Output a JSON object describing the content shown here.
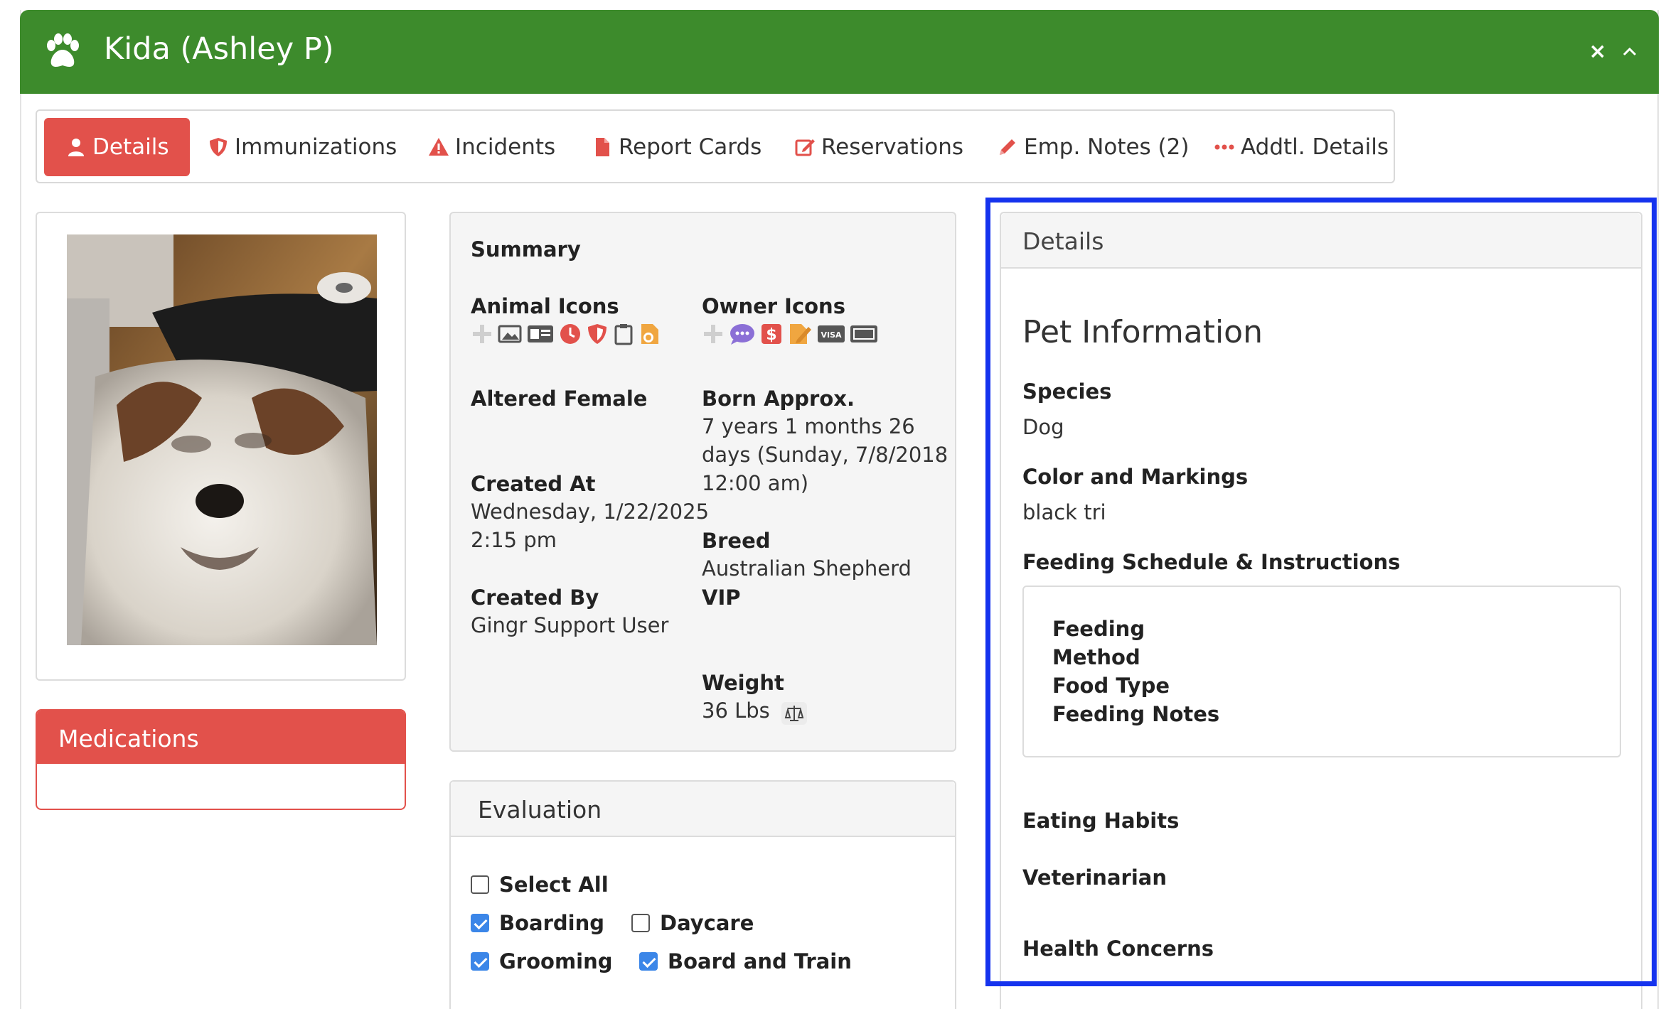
{
  "header": {
    "title": "Kida (Ashley P)",
    "close_symbol": "×",
    "collapse_symbol": "⌃",
    "accent": "#3d8b2c"
  },
  "tabs": [
    {
      "label": "Details",
      "icon": "user-icon"
    },
    {
      "label": "Immunizations",
      "icon": "shield-icon"
    },
    {
      "label": "Incidents",
      "icon": "warning-icon"
    },
    {
      "label": "Report Cards",
      "icon": "document-icon"
    },
    {
      "label": "Reservations",
      "icon": "edit-icon"
    },
    {
      "label": "Emp. Notes (2)",
      "icon": "pencil-icon"
    },
    {
      "label": "Addtl. Details",
      "icon": "ellipsis-icon"
    }
  ],
  "medications": {
    "title": "Medications"
  },
  "summary": {
    "title": "Summary",
    "animal_icons_label": "Animal Icons",
    "owner_icons_label": "Owner Icons",
    "altered": "Altered Female",
    "born_label": "Born Approx.",
    "born_lines": [
      "7 years 1 months 26",
      "days (Sunday, 7/8/2018",
      "12:00 am)"
    ],
    "created_at_label": "Created At",
    "created_at_lines": [
      "Wednesday, 1/22/2025",
      "2:15 pm"
    ],
    "breed_label": "Breed",
    "breed": "Australian Shepherd",
    "vip_label": "VIP",
    "created_by_label": "Created By",
    "created_by": "Gingr Support User",
    "weight_label": "Weight",
    "weight": "36 Lbs"
  },
  "evaluation": {
    "title": "Evaluation",
    "options": [
      {
        "label": "Select All",
        "checked": false
      },
      {
        "label": "Boarding",
        "checked": true
      },
      {
        "label": "Daycare",
        "checked": false
      },
      {
        "label": "Grooming",
        "checked": true
      },
      {
        "label": "Board and Train",
        "checked": true
      }
    ]
  },
  "details": {
    "title": "Details",
    "section": "Pet Information",
    "species_label": "Species",
    "species": "Dog",
    "color_label": "Color and Markings",
    "color": "black tri",
    "feeding_label": "Feeding Schedule & Instructions",
    "feeding_fields": [
      "Feeding",
      "Method",
      "Food Type",
      "Feeding Notes"
    ],
    "eating_label": "Eating Habits",
    "vet_label": "Veterinarian",
    "health_label": "Health Concerns"
  },
  "colors": {
    "primary_red": "#e2514b",
    "highlight": "#1533ee",
    "check_blue": "#3b86e8"
  }
}
